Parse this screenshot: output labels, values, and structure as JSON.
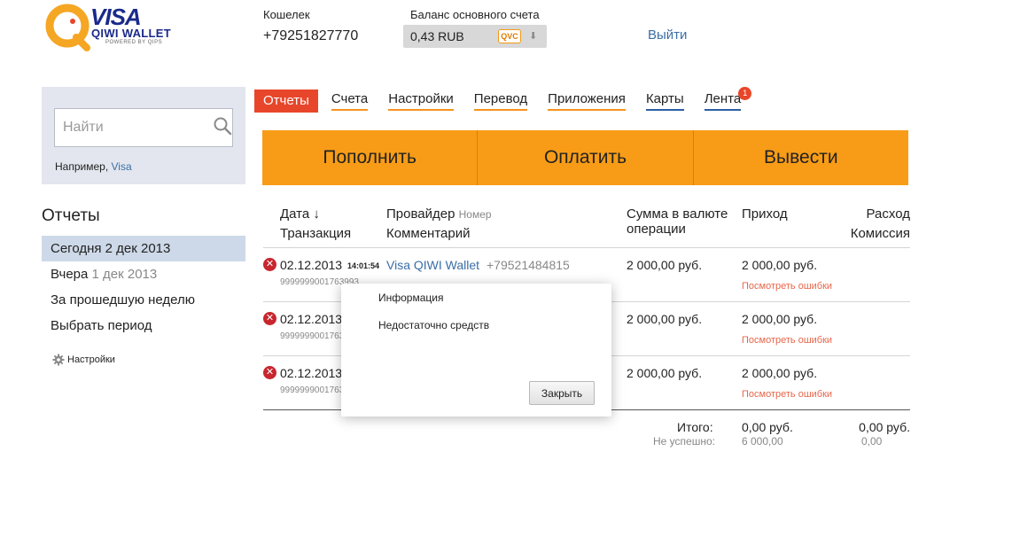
{
  "logo": {
    "brand": "VISA",
    "product": "QIWI WALLET",
    "powered": "POWERED BY QIPS"
  },
  "header": {
    "wallet_label": "Кошелек",
    "wallet_phone": "+79251827770",
    "balance_label": "Баланс основного счета",
    "balance_value": "0,43 RUB",
    "currency_badge": "QVC",
    "logout": "Выйти"
  },
  "search": {
    "placeholder": "Найти",
    "hint_prefix": "Например,",
    "hint_link": "Visa"
  },
  "sidebar": {
    "title": "Отчеты",
    "items": [
      {
        "label": "Сегодня 2 дек 2013",
        "note": ""
      },
      {
        "label": "Вчера",
        "note": "1 дек 2013"
      },
      {
        "label": "За прошедшую неделю",
        "note": ""
      },
      {
        "label": "Выбрать период",
        "note": ""
      }
    ],
    "settings": "Настройки"
  },
  "tabs": [
    {
      "label": "Отчеты"
    },
    {
      "label": "Счета"
    },
    {
      "label": "Настройки"
    },
    {
      "label": "Перевод"
    },
    {
      "label": "Приложения"
    },
    {
      "label": "Карты"
    },
    {
      "label": "Лента",
      "badge": "1"
    }
  ],
  "actions": [
    "Пополнить",
    "Оплатить",
    "Вывести"
  ],
  "table": {
    "headers": {
      "date": "Дата ↓",
      "transaction": "Транзакция",
      "provider": "Провайдер",
      "number": "Номер",
      "comment": "Комментарий",
      "amount_line1": "Сумма в валюте",
      "amount_line2": "операции",
      "income": "Приход",
      "expense": "Расход",
      "commission": "Комиссия"
    },
    "rows": [
      {
        "date": "02.12.2013",
        "time": "14:01:54",
        "txn": "9999999001763993",
        "provider": "Visa QIWI Wallet",
        "number": "+79521484815",
        "amount": "2 000,00 руб.",
        "income": "2 000,00 руб.",
        "errors": "Посмотреть ошибки"
      },
      {
        "date": "02.12.2013",
        "txn": "9999999001763",
        "amount": "2 000,00 руб.",
        "income": "2 000,00 руб.",
        "errors": "Посмотреть ошибки"
      },
      {
        "date": "02.12.2013",
        "txn": "9999999001763",
        "amount": "2 000,00 руб.",
        "income": "2 000,00 руб.",
        "errors": "Посмотреть ошибки"
      }
    ],
    "totals": {
      "label": "Итого:",
      "failed_label": "Не успешно:",
      "income": "0,00 руб.",
      "income_failed": "6 000,00",
      "expense": "0,00 руб.",
      "expense_failed": "0,00"
    }
  },
  "modal": {
    "title": "Информация",
    "message": "Недостаточно средств",
    "close": "Закрыть"
  }
}
